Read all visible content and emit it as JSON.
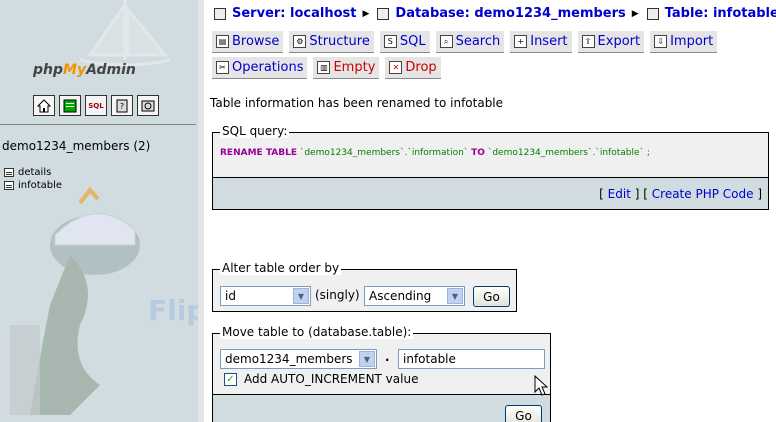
{
  "sidebar": {
    "logo": {
      "php": "php",
      "my": "My",
      "admin": "Admin"
    },
    "icons": [
      "home-icon",
      "query-window-icon",
      "sql-icon",
      "docs-icon",
      "help-icon"
    ],
    "icon_labels": [
      "",
      "",
      "SQL",
      "",
      ""
    ],
    "database_label": "demo1234_members (2)",
    "tables": [
      {
        "label": "details"
      },
      {
        "label": "infotable"
      }
    ],
    "watermark": "FlipperHost"
  },
  "breadcrumb": {
    "server": "Server: localhost",
    "database": "Database: demo1234_members",
    "table": "Table: infotable"
  },
  "tabs_row1": [
    {
      "label": "Browse",
      "icon": "▤"
    },
    {
      "label": "Structure",
      "icon": "⚙"
    },
    {
      "label": "SQL",
      "icon": "S"
    },
    {
      "label": "Search",
      "icon": "⌕"
    },
    {
      "label": "Insert",
      "icon": "+"
    },
    {
      "label": "Export",
      "icon": "⇪"
    },
    {
      "label": "Import",
      "icon": "⇩"
    }
  ],
  "tabs_row2": [
    {
      "label": "Operations",
      "icon": "✂"
    },
    {
      "label": "Empty",
      "icon": "▥"
    },
    {
      "label": "Drop",
      "icon": "✕"
    }
  ],
  "message": "Table information has been renamed to infotable",
  "sql_query": {
    "legend": "SQL query:",
    "kw1": "RENAME TABLE",
    "s1": "`demo1234_members`.`information`",
    "kw2": "TO",
    "s2": "`demo1234_members`.`infotable`",
    "end": ";",
    "edit": "Edit",
    "create_php": "Create PHP Code"
  },
  "alter_order": {
    "legend": "Alter table order by",
    "column": "id",
    "singly": "(singly)",
    "direction": "Ascending",
    "go": "Go"
  },
  "move_table": {
    "legend": "Move table to (database.table):",
    "database": "demo1234_members",
    "dot": ".",
    "table_name": "infotable",
    "auto_increment_label": "Add AUTO_INCREMENT value",
    "auto_increment_checked": true,
    "go": "Go"
  }
}
